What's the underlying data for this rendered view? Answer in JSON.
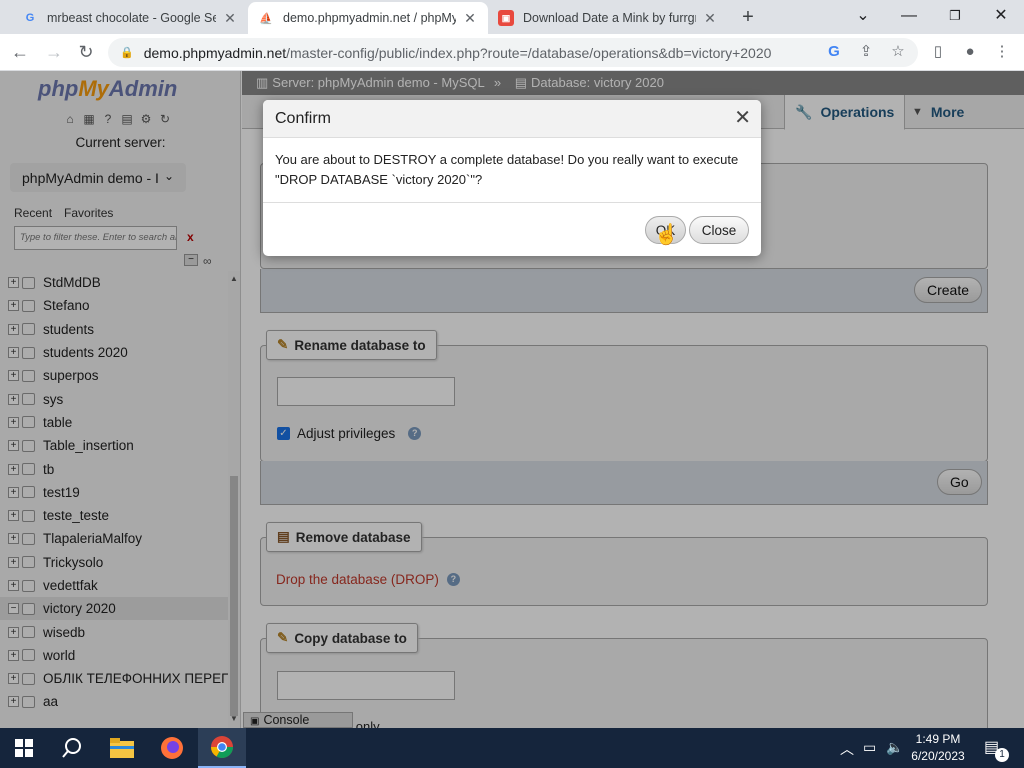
{
  "browser": {
    "tabs": [
      {
        "title": "mrbeast chocolate - Google Sear",
        "favicon": "google-icon"
      },
      {
        "title": "demo.phpmyadmin.net / phpMy",
        "favicon": "phpmyadmin-icon"
      },
      {
        "title": "Download Date a Mink by furrgr",
        "favicon": "itch-icon"
      }
    ],
    "new_tab_label": "+",
    "url_host": "demo.phpmyadmin.net",
    "url_path": "/master-config/public/index.php?route=/database/operations&db=victory+2020"
  },
  "nav": {
    "logo_php": "php",
    "logo_my": "My",
    "logo_admin": "Admin",
    "current_server_label": "Current server:",
    "server_select": "phpMyAdmin demo - I",
    "tab_recent": "Recent",
    "tab_favorites": "Favorites",
    "filter_placeholder": "Type to filter these. Enter to search al",
    "filter_clear": "x",
    "databases": [
      "StdMdDB",
      "Stefano",
      "students",
      "students 2020",
      "superpos",
      "sys",
      "table",
      "Table_insertion",
      "tb",
      "test19",
      "teste_teste",
      "TlapaleriaMalfoy",
      "Trickysolo",
      "vedettfak",
      "victory 2020",
      "wisedb",
      "world",
      "ОБЛІК ТЕЛЕФОННИХ ПЕРЕГ",
      "aa"
    ],
    "selected_db": "victory 2020"
  },
  "main": {
    "breadcrumb_server": "Server: phpMyAdmin demo - MySQL",
    "breadcrumb_sep": "»",
    "breadcrumb_db": "Database: victory 2020",
    "tab_partial": "rt",
    "tab_operations": "Operations",
    "tab_more": "More",
    "create_button": "Create",
    "rename_legend": "Rename database to",
    "adjust_privileges": "Adjust privileges",
    "go_button": "Go",
    "remove_legend": "Remove database",
    "drop_link": "Drop the database (DROP)",
    "copy_legend": "Copy database to",
    "structure_only_partial": "ucture only",
    "console_label": "Console"
  },
  "dialog": {
    "title": "Confirm",
    "message": "You are about to DESTROY a complete database! Do you really want to execute \"DROP DATABASE `victory 2020`\"?",
    "ok_label": "OK",
    "close_label": "Close"
  },
  "taskbar": {
    "time": "1:49 PM",
    "date": "6/20/2023",
    "notification_count": "1"
  }
}
